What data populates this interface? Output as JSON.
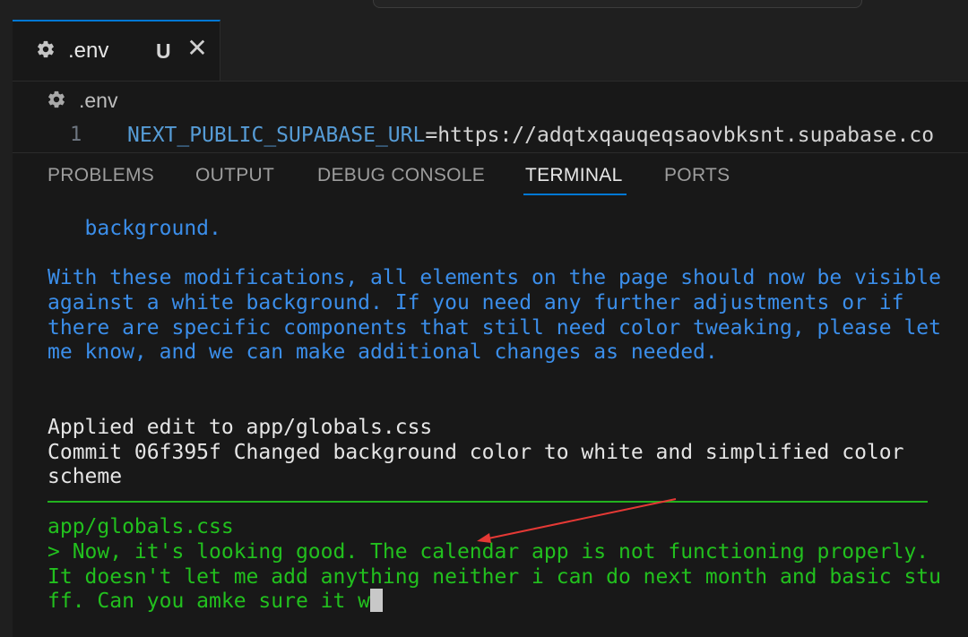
{
  "editor": {
    "tab": {
      "name": ".env",
      "status": "U",
      "close": "✕"
    },
    "breadcrumb": ".env",
    "line": {
      "number": "1",
      "key": "NEXT_PUBLIC_SUPABASE_URL",
      "equals": "=",
      "value": "https://adqtxqauqeqsaovbksnt.supabase.co"
    }
  },
  "panel": {
    "tabs": [
      "PROBLEMS",
      "OUTPUT",
      "DEBUG CONSOLE",
      "TERMINAL",
      "PORTS"
    ],
    "active_tab": "TERMINAL"
  },
  "terminal": {
    "assistant_lines": [
      "   background.",
      "With these modifications, all elements on the page should now be visible",
      "against a white background. If you need any further adjustments or if",
      "there are specific components that still need color tweaking, please let",
      "me know, and we can make additional changes as needed."
    ],
    "log_lines": [
      "Applied edit to app/globals.css",
      "Commit 06f395f Changed background color to white and simplified color",
      "scheme"
    ],
    "prompt_file": "app/globals.css",
    "input_lines": [
      "> Now, it's looking good. The calendar app is not functioning properly.",
      "It doesn't let me add anything neither i can do next month and basic stu",
      "ff. Can you amke sure it w"
    ]
  },
  "colors": {
    "assistant_text": "#3b8eea",
    "log_text": "#e5e5e5",
    "input_text": "#22c01e",
    "annotation_arrow": "#e53935",
    "active_tab_underline": "#0078d4"
  }
}
